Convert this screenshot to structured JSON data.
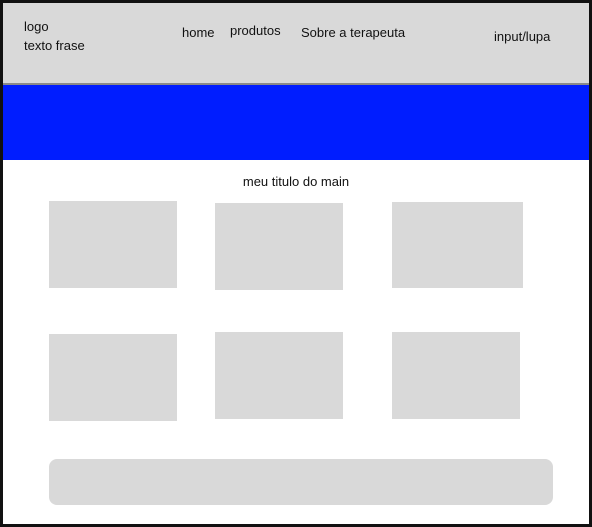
{
  "header": {
    "logo_text": "logo",
    "tagline": "texto frase",
    "nav": {
      "home": "home",
      "produtos": "produtos",
      "sobre": "Sobre a terapeuta"
    },
    "search_placeholder_text": "input/lupa",
    "background_color": "#d9d9d9"
  },
  "banner": {
    "color": "#001dff"
  },
  "main": {
    "title": "meu titulo do main",
    "card_color": "#d9d9d9",
    "card_count": 6
  },
  "footer": {
    "color": "#d9d9d9"
  }
}
